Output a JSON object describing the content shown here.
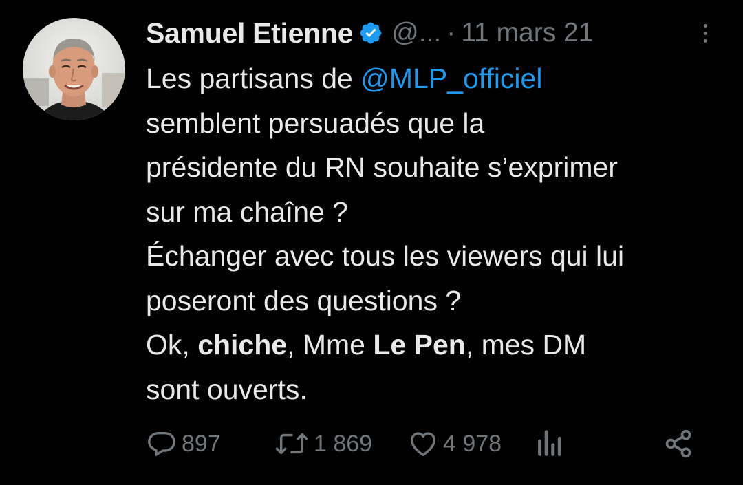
{
  "author": {
    "display_name": "Samuel Etienne",
    "handle": "@...",
    "separator": "·",
    "date": "11 mars 21",
    "avatar_icon": "avatar-photo",
    "verified_color": "#1d9bf0"
  },
  "tweet": {
    "line1_pre": "Les partisans de ",
    "mention": "@MLP_officiel",
    "line2": "semblent persuadés que la",
    "line3": "présidente du RN souhaite s’exprimer",
    "line4": "sur ma chaîne ?",
    "line5": "Échanger avec tous les viewers qui lui",
    "line6": "poseront des questions ?",
    "line7_a": "Ok, ",
    "line7_b": "chiche",
    "line7_c": ", Mme ",
    "line7_d": "Le Pen",
    "line7_e": ", mes DM",
    "line8": "sont ouverts."
  },
  "actions": {
    "reply_count": "897",
    "retweet_count": "1 869",
    "like_count": "4 978",
    "reply_icon": "reply-icon",
    "retweet_icon": "retweet-icon",
    "like_icon": "heart-icon",
    "views_icon": "analytics-icon",
    "share_icon": "share-icon"
  },
  "colors": {
    "background": "#000000",
    "text": "#e7e9ea",
    "secondary": "#71767b",
    "link": "#1d9bf0"
  }
}
